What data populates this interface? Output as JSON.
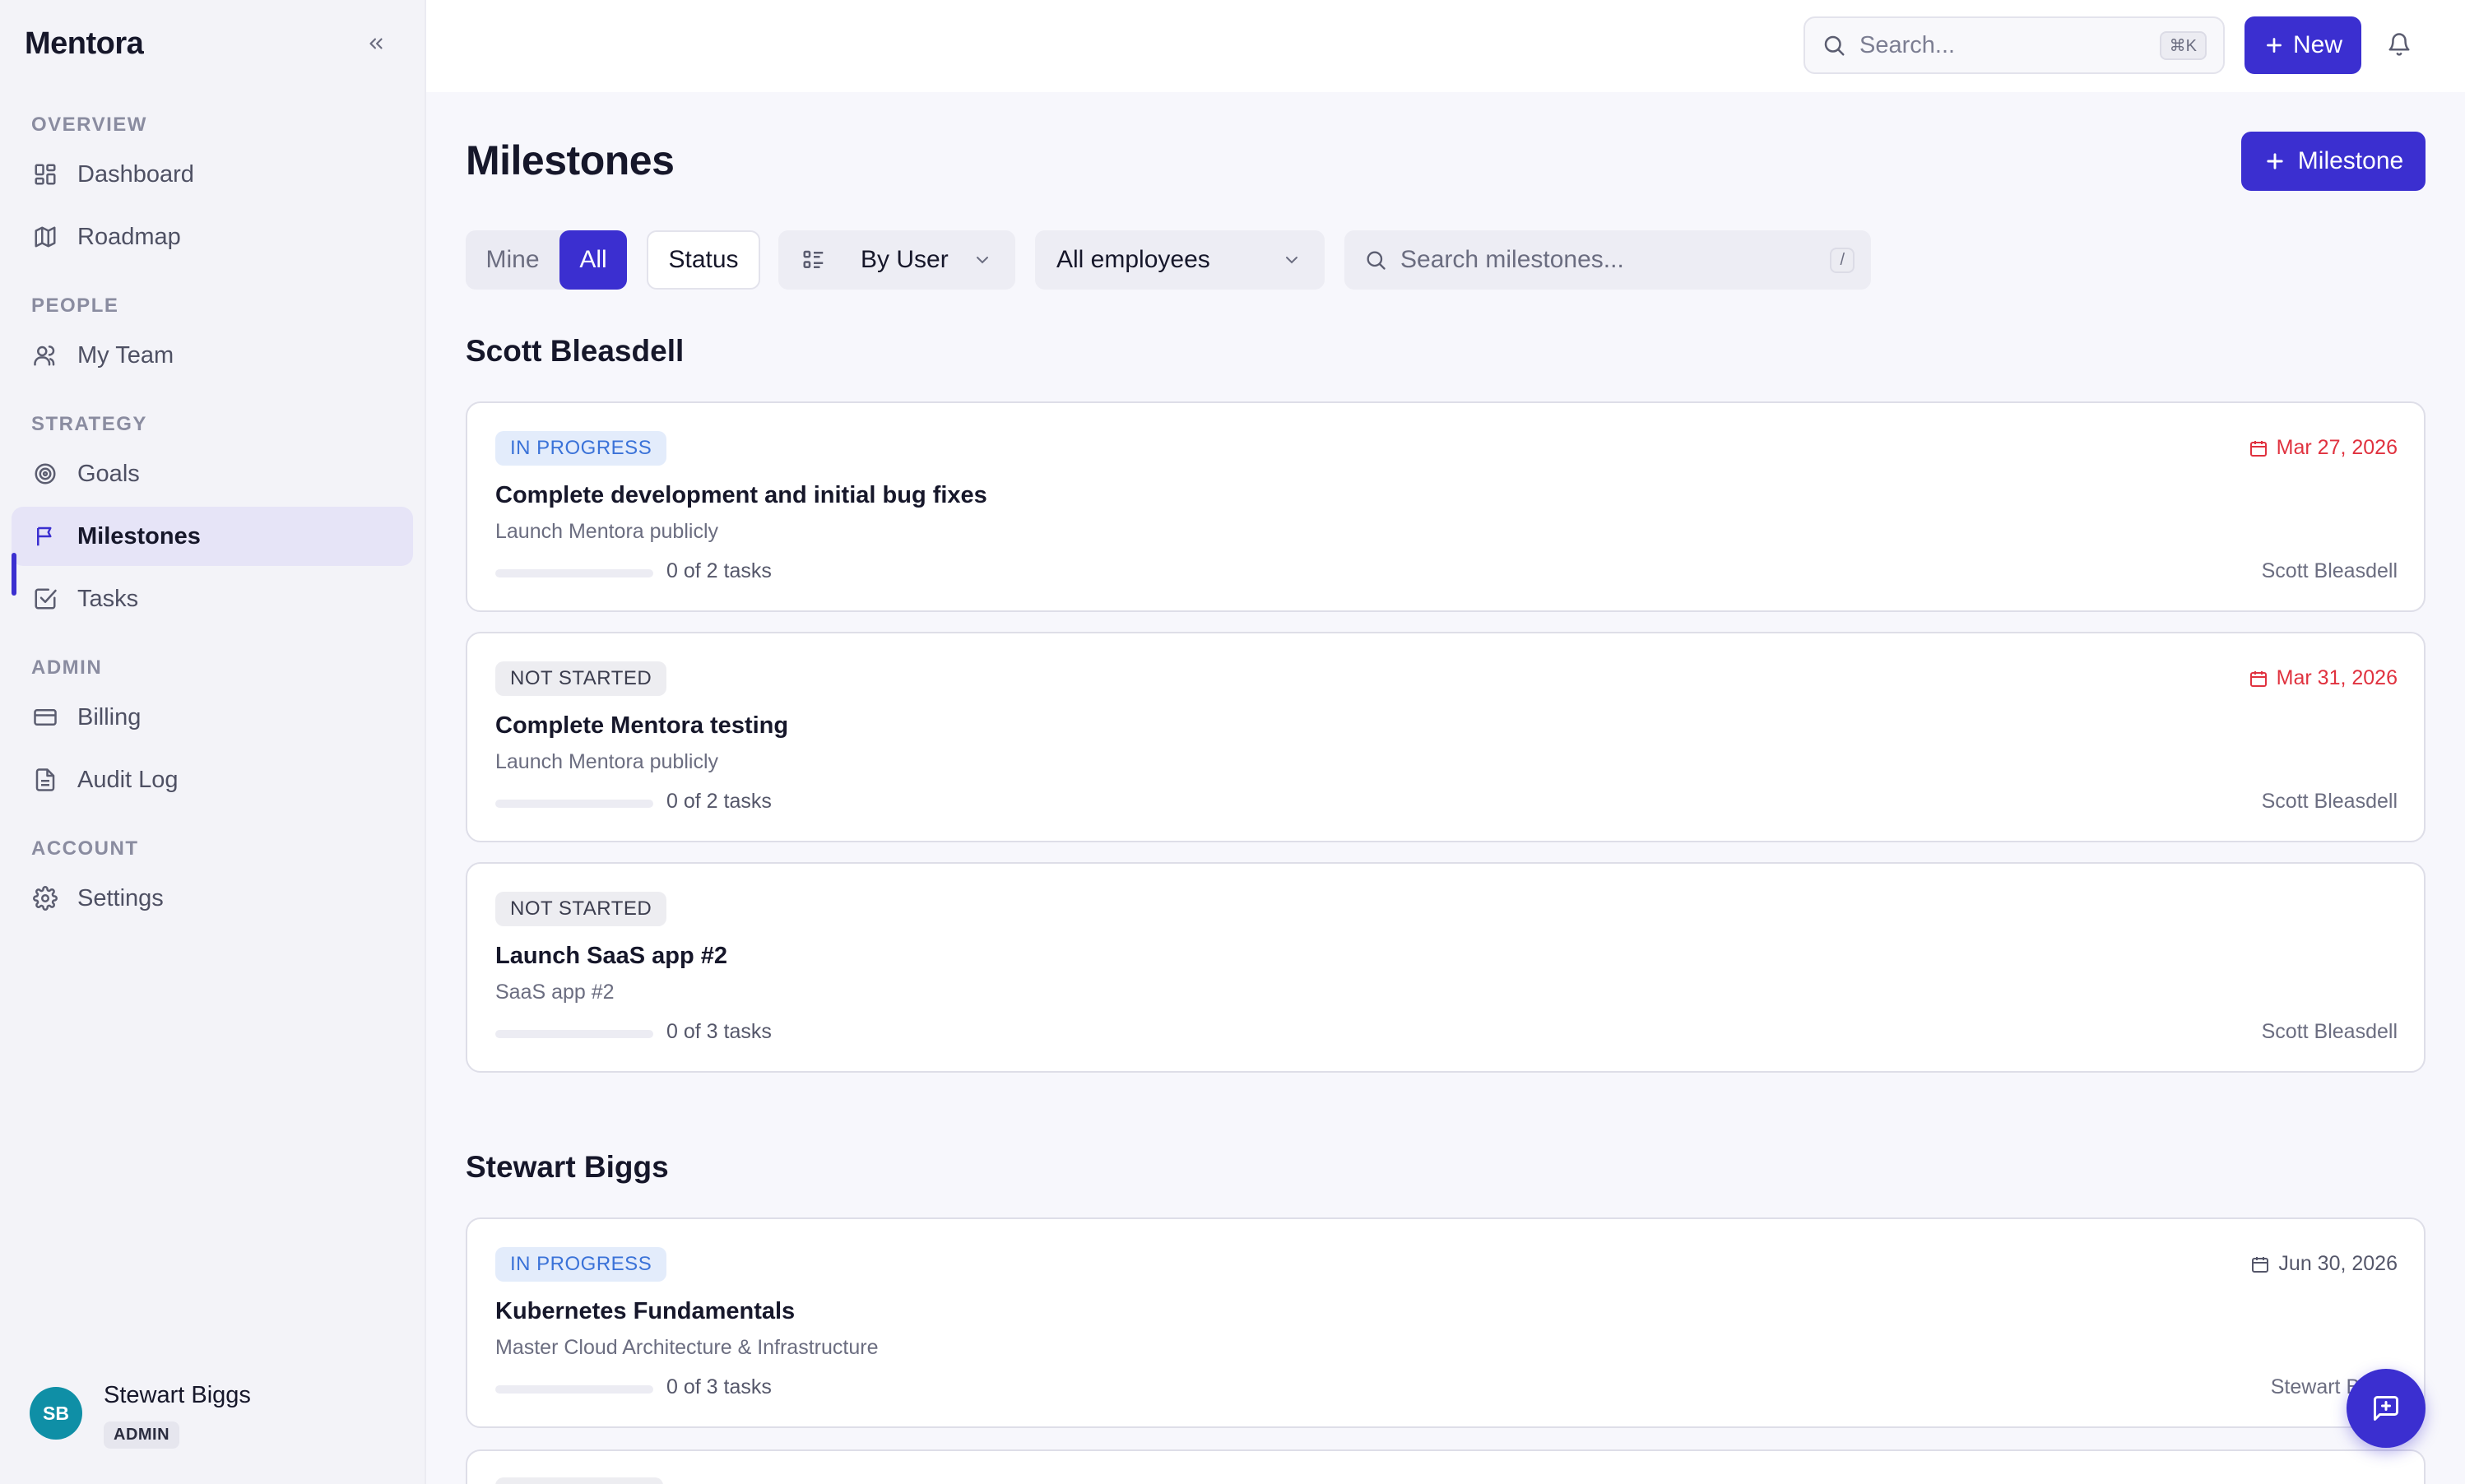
{
  "app": {
    "name": "Mentora"
  },
  "sidebar": {
    "sections": [
      {
        "label": "OVERVIEW",
        "items": [
          {
            "label": "Dashboard",
            "icon": "dashboard-icon"
          },
          {
            "label": "Roadmap",
            "icon": "map-icon"
          }
        ]
      },
      {
        "label": "PEOPLE",
        "items": [
          {
            "label": "My Team",
            "icon": "users-icon"
          }
        ]
      },
      {
        "label": "STRATEGY",
        "items": [
          {
            "label": "Goals",
            "icon": "target-icon"
          },
          {
            "label": "Milestones",
            "icon": "flag-icon",
            "active": true
          },
          {
            "label": "Tasks",
            "icon": "checkbox-icon"
          }
        ]
      },
      {
        "label": "ADMIN",
        "items": [
          {
            "label": "Billing",
            "icon": "credit-card-icon"
          },
          {
            "label": "Audit Log",
            "icon": "document-icon"
          }
        ]
      },
      {
        "label": "ACCOUNT",
        "items": [
          {
            "label": "Settings",
            "icon": "gear-icon"
          }
        ]
      }
    ],
    "user": {
      "initials": "SB",
      "name": "Stewart Biggs",
      "role": "ADMIN"
    }
  },
  "topbar": {
    "search_placeholder": "Search...",
    "search_shortcut": "⌘K",
    "new_label": "New"
  },
  "page": {
    "title": "Milestones",
    "add_button_label": "Milestone"
  },
  "filters": {
    "scope_options": [
      "Mine",
      "All"
    ],
    "scope_selected": "All",
    "status_label": "Status",
    "group_by": "By User",
    "employees": "All employees",
    "search_placeholder": "Search milestones...",
    "search_shortcut": "/"
  },
  "groups": [
    {
      "name": "Scott Bleasdell",
      "milestones": [
        {
          "status": "IN PROGRESS",
          "status_key": "inprogress",
          "due": "Mar 27, 2026",
          "overdue": true,
          "title": "Complete development and initial bug fixes",
          "goal": "Launch Mentora publicly",
          "progress": 0,
          "tasks": "0 of 2 tasks",
          "owner": "Scott Bleasdell"
        },
        {
          "status": "NOT STARTED",
          "status_key": "notstarted",
          "due": "Mar 31, 2026",
          "overdue": true,
          "title": "Complete Mentora testing",
          "goal": "Launch Mentora publicly",
          "progress": 0,
          "tasks": "0 of 2 tasks",
          "owner": "Scott Bleasdell"
        },
        {
          "status": "NOT STARTED",
          "status_key": "notstarted",
          "due": "",
          "overdue": false,
          "title": "Launch SaaS app #2",
          "goal": "SaaS app #2",
          "progress": 0,
          "tasks": "0 of 3 tasks",
          "owner": "Scott Bleasdell"
        }
      ]
    },
    {
      "name": "Stewart Biggs",
      "milestones": [
        {
          "status": "IN PROGRESS",
          "status_key": "inprogress",
          "due": "Jun 30, 2026",
          "overdue": false,
          "title": "Kubernetes Fundamentals",
          "goal": "Master Cloud Architecture & Infrastructure",
          "progress": 0,
          "tasks": "0 of 3 tasks",
          "owner": "Stewart Biggs"
        }
      ]
    }
  ],
  "colors": {
    "accent": "#3b2fd0",
    "overdue": "#e0323f",
    "in_progress_text": "#3a72d8"
  }
}
